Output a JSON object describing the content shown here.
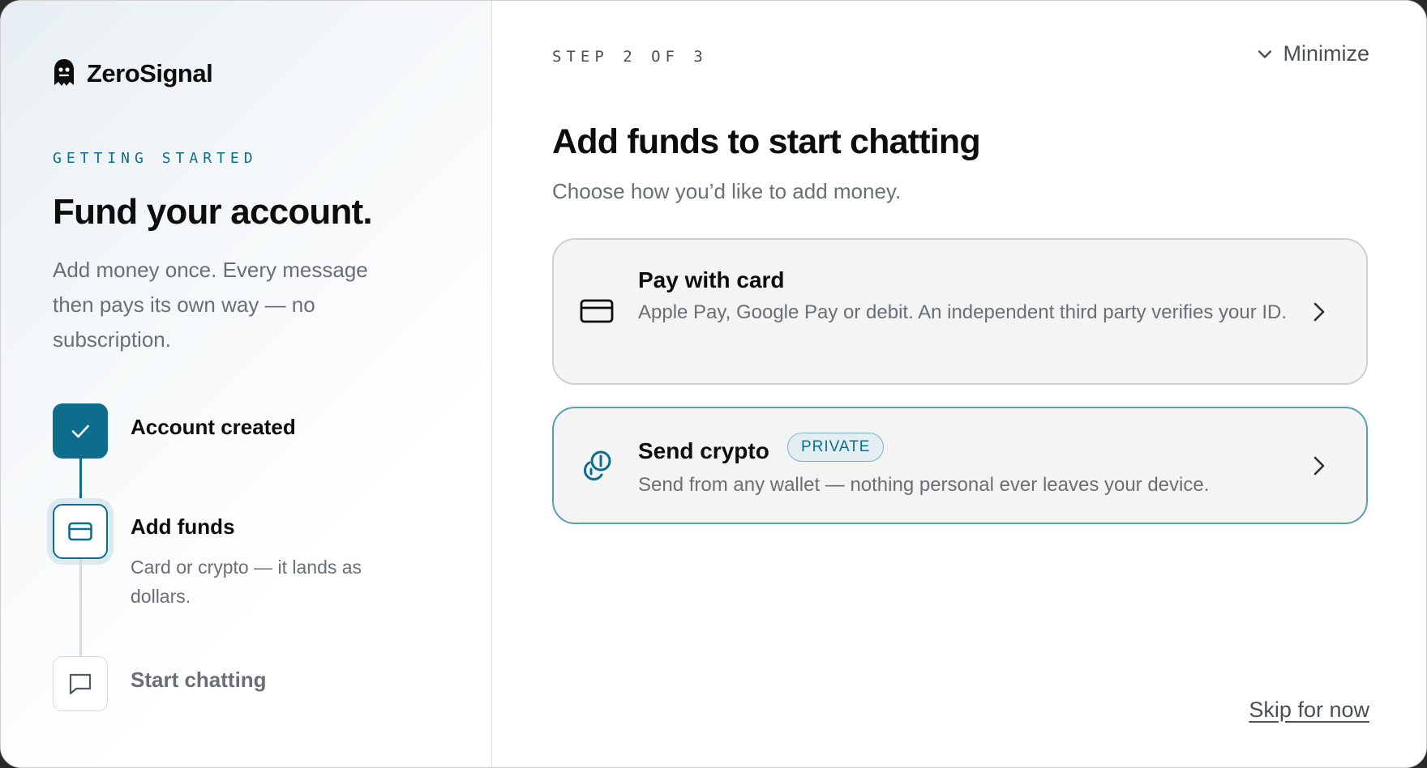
{
  "brand": {
    "name": "ZeroSignal",
    "icon": "ghost-logo-icon"
  },
  "left": {
    "eyebrow": "GETTING STARTED",
    "headline": "Fund your account.",
    "subhead": "Add money once. Every message then pays its own way — no subscription.",
    "steps": [
      {
        "title": "Account created",
        "state": "done",
        "icon": "check-icon"
      },
      {
        "title": "Add funds",
        "description": "Card or crypto — it lands as dollars.",
        "state": "active",
        "icon": "credit-card-icon"
      },
      {
        "title": "Start chatting",
        "state": "todo",
        "icon": "chat-bubble-icon"
      }
    ]
  },
  "right": {
    "step_count": "STEP 2 OF 3",
    "minimize_label": "Minimize",
    "title": "Add funds to start chatting",
    "subtitle": "Choose how you’d like to add money.",
    "options": [
      {
        "title": "Pay with card",
        "description": "Apple Pay, Google Pay or debit. An independent third party verifies your ID.",
        "icon": "credit-card-icon"
      },
      {
        "title": "Send crypto",
        "badge": "PRIVATE",
        "description": "Send from any wallet — nothing personal ever leaves your device.",
        "icon": "crypto-coins-icon"
      }
    ],
    "skip_label": "Skip for now"
  },
  "colors": {
    "accent": "#0e6d8c",
    "accent_light": "#dceaf0",
    "text_primary": "#0d0d0d",
    "text_secondary": "#6a6f73",
    "card_bg": "#f4f4f4"
  }
}
